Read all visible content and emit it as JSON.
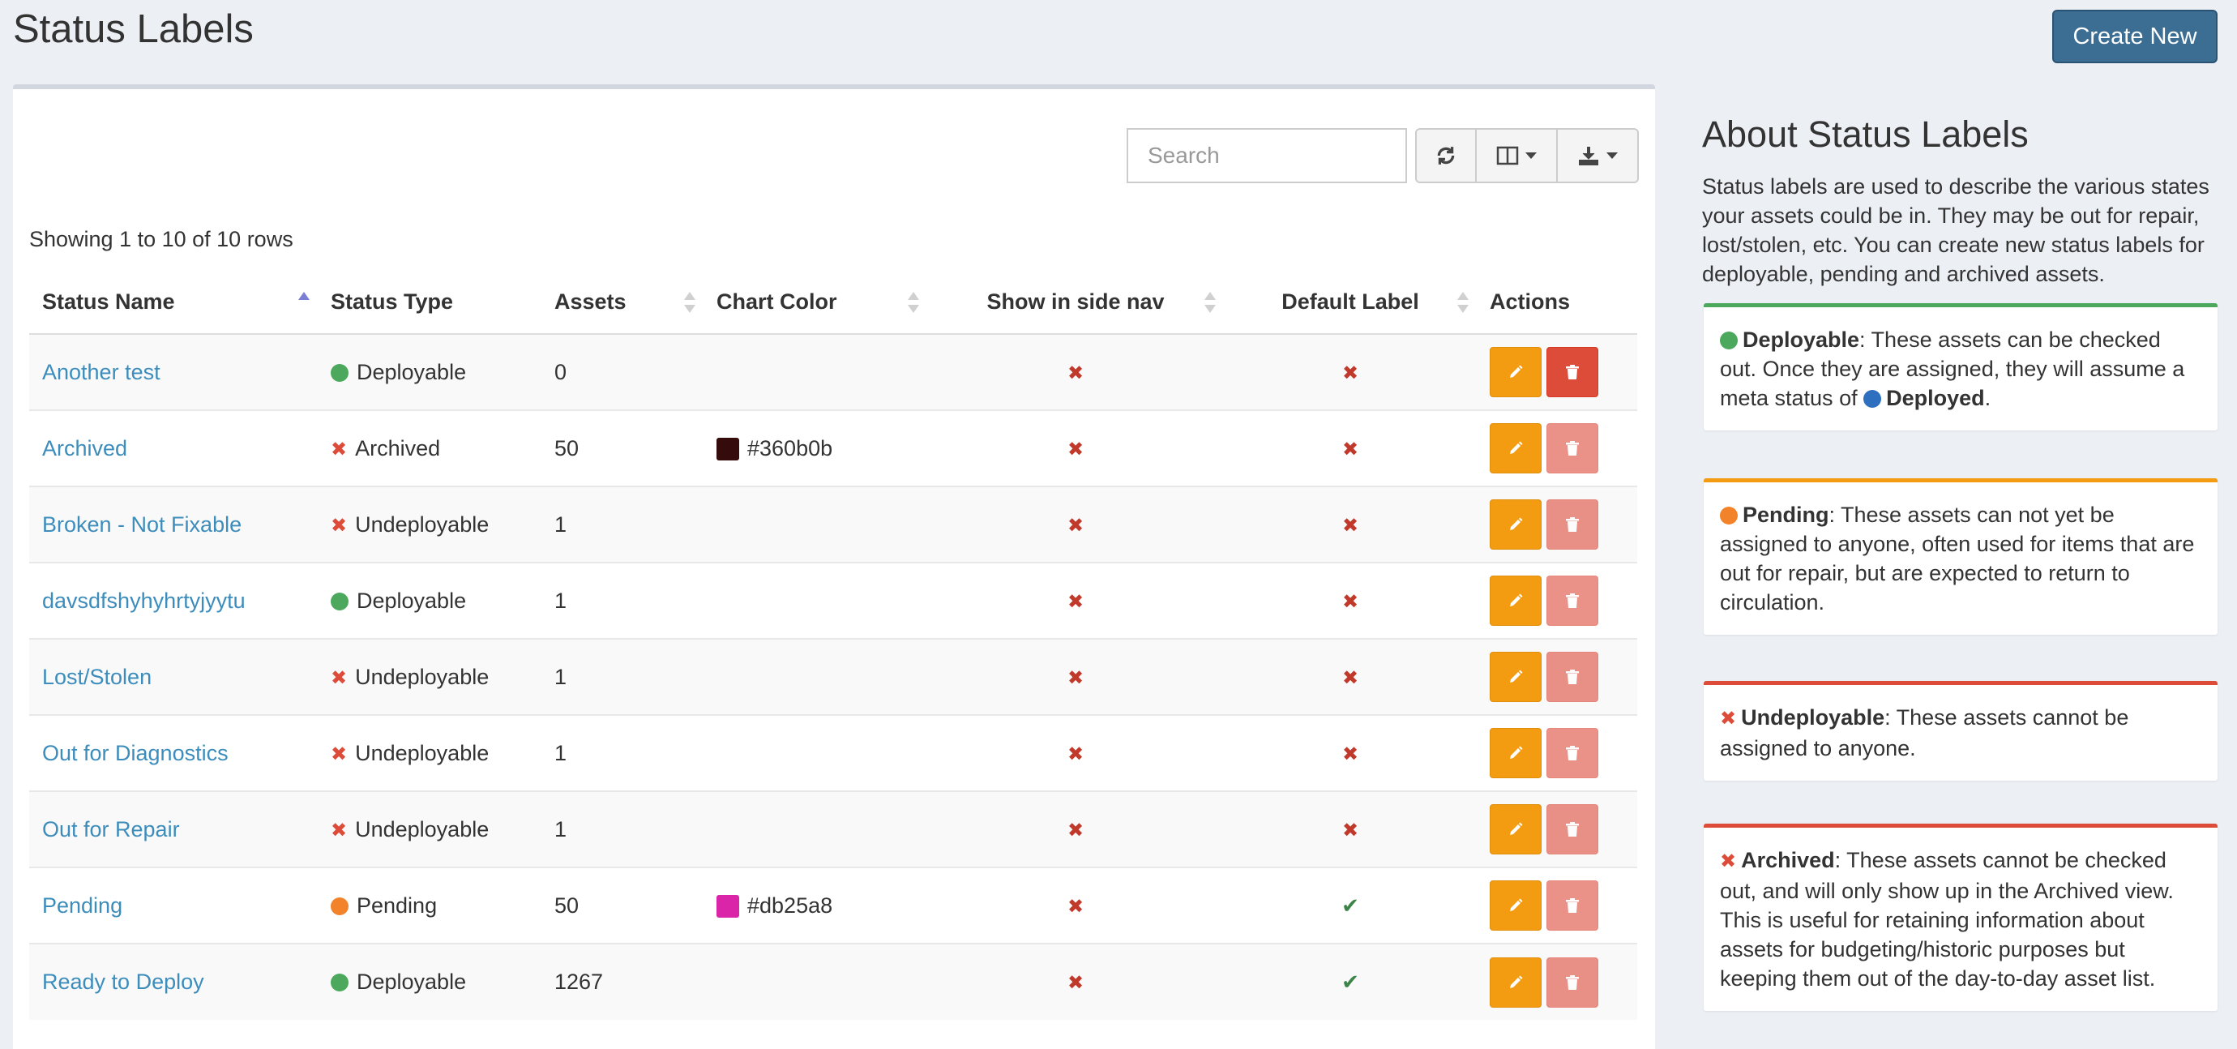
{
  "page": {
    "title": "Status Labels",
    "create_button": "Create New"
  },
  "toolbar": {
    "search_placeholder": "Search"
  },
  "table": {
    "rows_info": "Showing 1 to 10 of 10 rows",
    "headers": {
      "name": "Status Name",
      "type": "Status Type",
      "assets": "Assets",
      "chart_color": "Chart Color",
      "show_in_nav": "Show in side nav",
      "default_label": "Default Label",
      "actions": "Actions"
    },
    "rows": [
      {
        "name": "Another test",
        "type": "Deployable",
        "type_kind": "deployable",
        "assets": "0",
        "color": "",
        "show_nav": false,
        "default": false,
        "delete_enabled": true
      },
      {
        "name": "Archived",
        "type": "Archived",
        "type_kind": "x",
        "assets": "50",
        "color": "#360b0b",
        "show_nav": false,
        "default": false,
        "delete_enabled": false
      },
      {
        "name": "Broken - Not Fixable",
        "type": "Undeployable",
        "type_kind": "x",
        "assets": "1",
        "color": "",
        "show_nav": false,
        "default": false,
        "delete_enabled": false
      },
      {
        "name": "davsdfshyhyhrtyjyytu",
        "type": "Deployable",
        "type_kind": "deployable",
        "assets": "1",
        "color": "",
        "show_nav": false,
        "default": false,
        "delete_enabled": false
      },
      {
        "name": "Lost/Stolen",
        "type": "Undeployable",
        "type_kind": "x",
        "assets": "1",
        "color": "",
        "show_nav": false,
        "default": false,
        "delete_enabled": false
      },
      {
        "name": "Out for Diagnostics",
        "type": "Undeployable",
        "type_kind": "x",
        "assets": "1",
        "color": "",
        "show_nav": false,
        "default": false,
        "delete_enabled": false
      },
      {
        "name": "Out for Repair",
        "type": "Undeployable",
        "type_kind": "x",
        "assets": "1",
        "color": "",
        "show_nav": false,
        "default": false,
        "delete_enabled": false
      },
      {
        "name": "Pending",
        "type": "Pending",
        "type_kind": "pending",
        "assets": "50",
        "color": "#db25a8",
        "show_nav": false,
        "default": true,
        "delete_enabled": false
      },
      {
        "name": "Ready to Deploy",
        "type": "Deployable",
        "type_kind": "deployable",
        "assets": "1267",
        "color": "",
        "show_nav": false,
        "default": true,
        "delete_enabled": false
      }
    ]
  },
  "sidebar": {
    "title": "About Status Labels",
    "description": "Status labels are used to describe the various states your assets could be in. They may be out for repair, lost/stolen, etc. You can create new status labels for deployable, pending and archived assets.",
    "deployable": {
      "term": "Deployable",
      "text": ": These assets can be checked out. Once they are assigned, they will assume a meta status of ",
      "meta": "Deployed",
      "end": "."
    },
    "pending": {
      "term": "Pending",
      "text": ": These assets can not yet be assigned to anyone, often used for items that are out for repair, but are expected to return to circulation."
    },
    "undeployable": {
      "term": "Undeployable",
      "text": ": These assets cannot be assigned to anyone."
    },
    "archived": {
      "term": "Archived",
      "text": ": These assets cannot be checked out, and will only show up in the Archived view. This is useful for retaining information about assets for budgeting/historic purposes but keeping them out of the day-to-day asset list."
    }
  },
  "colors": {
    "deployable": "#4ca85c",
    "pending": "#f2832a",
    "deployed": "#2e6fbf",
    "danger": "#dd4b39",
    "link": "#3c8dbc",
    "primary": "#3c6e93"
  }
}
